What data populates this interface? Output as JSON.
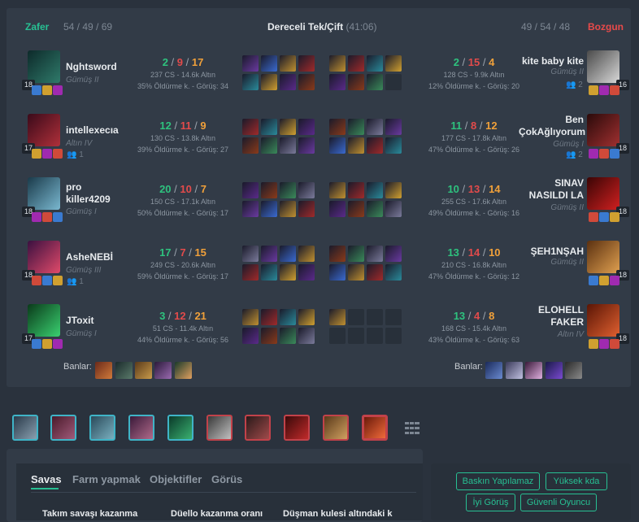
{
  "header": {
    "left_result": "Zafer",
    "left_team_score": "54 / 49 / 69",
    "mode": "Dereceli Tek/Çift",
    "duration": "(41:06)",
    "right_team_score": "49 / 54 / 48",
    "right_result": "Bozgun"
  },
  "left_players": [
    {
      "name": "Nghtsword",
      "rank": "Gümüş II",
      "level": "18",
      "kills": "2",
      "deaths": "9",
      "assists": "17",
      "cs_gold": "237 CS - 14.6k Altın",
      "kp_vision": "35% Öldürme k. - Görüş: 34",
      "party": ""
    },
    {
      "name": "intellexecıa",
      "rank": "Altın IV",
      "level": "17",
      "kills": "12",
      "deaths": "11",
      "assists": "9",
      "cs_gold": "130 CS - 13.8k Altın",
      "kp_vision": "39% Öldürme k. - Görüş: 27",
      "party": "1"
    },
    {
      "name": "pro killer4209",
      "rank": "Gümüş I",
      "level": "18",
      "kills": "20",
      "deaths": "10",
      "assists": "7",
      "cs_gold": "150 CS - 17.1k Altın",
      "kp_vision": "50% Öldürme k. - Görüş: 17",
      "party": ""
    },
    {
      "name": "AsheNEBİ",
      "rank": "Gümüş III",
      "level": "18",
      "kills": "17",
      "deaths": "7",
      "assists": "15",
      "cs_gold": "249 CS - 20.6k Altın",
      "kp_vision": "59% Öldürme k. - Görüş: 17",
      "party": "1"
    },
    {
      "name": "JToxit",
      "rank": "Gümüş I",
      "level": "17",
      "kills": "3",
      "deaths": "12",
      "assists": "21",
      "cs_gold": "51 CS - 11.4k Altın",
      "kp_vision": "44% Öldürme k. - Görüş: 56",
      "party": ""
    }
  ],
  "right_players": [
    {
      "name": "kite baby kite",
      "rank": "Gümüş II",
      "level": "16",
      "kills": "2",
      "deaths": "15",
      "assists": "4",
      "cs_gold": "128 CS - 9.9k Altın",
      "kp_vision": "12% Öldürme k. - Görüş: 20",
      "party": "2"
    },
    {
      "name": "Ben ÇokAğlıyorum",
      "rank": "Gümüş I",
      "level": "18",
      "kills": "11",
      "deaths": "8",
      "assists": "12",
      "cs_gold": "177 CS - 17.8k Altın",
      "kp_vision": "47% Öldürme k. - Görüş: 26",
      "party": "2"
    },
    {
      "name": "SINAV NASILDI LA",
      "rank": "Gümüş II",
      "level": "18",
      "kills": "10",
      "deaths": "13",
      "assists": "14",
      "cs_gold": "255 CS - 17.6k Altın",
      "kp_vision": "49% Öldürme k. - Görüş: 16",
      "party": ""
    },
    {
      "name": "ŞEH1NŞAH",
      "rank": "Gümüş II",
      "level": "18",
      "kills": "13",
      "deaths": "14",
      "assists": "10",
      "cs_gold": "210 CS - 16.8k Altın",
      "kp_vision": "47% Öldürme k. - Görüş: 12",
      "party": ""
    },
    {
      "name": "ELOHELL FAKER",
      "rank": "Altın IV",
      "level": "18",
      "kills": "13",
      "deaths": "4",
      "assists": "8",
      "cs_gold": "168 CS - 15.4k Altın",
      "kp_vision": "43% Öldürme k. - Görüş: 63",
      "party": ""
    }
  ],
  "bans_label": "Banlar:",
  "tabs": [
    "Savas",
    "Farm yapmak",
    "Objektifler",
    "Görüs"
  ],
  "stat_headers": [
    "Takım savaşı kazanma",
    "Düello kazanma oranı",
    "Düşman kulesi altındaki k"
  ],
  "tags": [
    "Baskın Yapılamaz",
    "Yüksek kda",
    "İyi Görüş",
    "Güvenli Oyuncu"
  ],
  "colors": {
    "win": "#27c093",
    "loss": "#e84a4a",
    "panel": "#323b47",
    "background": "#2a323d"
  }
}
